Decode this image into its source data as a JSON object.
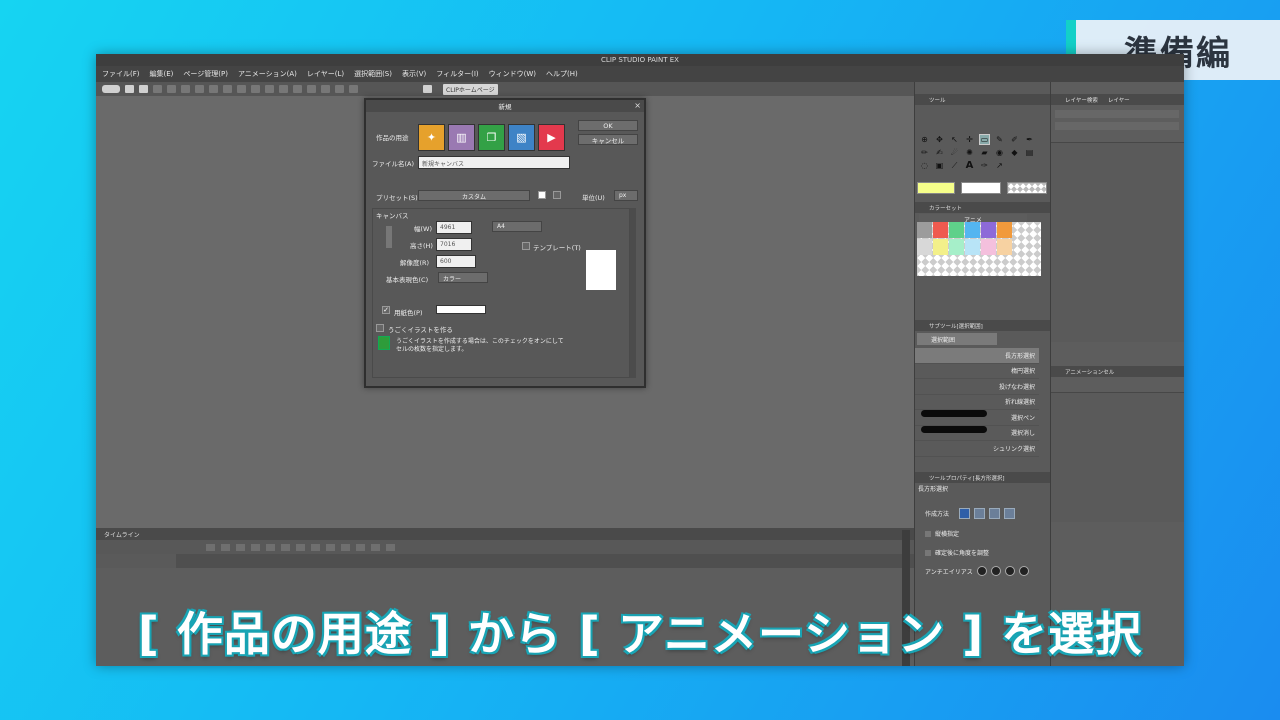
{
  "section_tag": "準備編",
  "caption": "[ 作品の用途 ] から [ アニメーション ] を選択",
  "app": {
    "title": "CLIP STUDIO PAINT EX",
    "menu": [
      "ファイル(F)",
      "編集(E)",
      "ページ管理(P)",
      "アニメーション(A)",
      "レイヤー(L)",
      "選択範囲(S)",
      "表示(V)",
      "フィルター(I)",
      "ウィンドウ(W)",
      "ヘルプ(H)"
    ],
    "clip_home_button": "CLIPホームページ"
  },
  "dialog": {
    "title": "新規",
    "use_label": "作品の用途",
    "ok": "OK",
    "cancel": "キャンセル",
    "filename_label": "ファイル名(A)",
    "filename_value": "新規キャンバス",
    "preset_label": "プリセット(S)",
    "preset_value": "カスタム",
    "unit_label": "単位(U)",
    "unit_value": "px",
    "canvas_section": "キャンバス",
    "width_label": "幅(W)",
    "width_value": "4961",
    "height_label": "高さ(H)",
    "height_value": "7016",
    "size_value": "A4",
    "resolution_label": "解像度(R)",
    "resolution_value": "600",
    "template_label": "テンプレート(T)",
    "color_mode_label": "基本表現色(C)",
    "color_mode_value": "カラー",
    "paper_color_label": "用紙色(P)",
    "animated_illust_label": "うごくイラストを作る",
    "info_text_1": "うごくイラストを作成する場合は、このチェックをオンにして",
    "info_text_2": "セルの枚数を指定します。"
  },
  "panels": {
    "tool_tab": "ツール",
    "color_set_tab": "カラーセット",
    "color_set_name": "アニメ",
    "subtool_tab": "サブツール[選択範囲]",
    "subtool_group": "選択範囲",
    "subtools": [
      "長方形選択",
      "楕円選択",
      "投げなわ選択",
      "折れ線選択",
      "選択ペン",
      "選択消し",
      "シュリンク選択"
    ],
    "tool_property_tab": "ツールプロパティ[長方形選択]",
    "tool_property_title": "長方形選択",
    "creation_method_label": "作成方法",
    "aspect_label": "縦横指定",
    "adjust_angle_label": "確定後に角度を調整",
    "antialias_label": "アンチエイリアス",
    "layer_tab": "レイヤー",
    "layer_props_tab": "レイヤー検索",
    "animation_cel_tab": "アニメーションセル",
    "timeline_tab": "タイムライン"
  },
  "colors": {
    "accent_teal": "#13d0c8",
    "selected_tool_blue": "#2f5fa8",
    "swatch_main": "#f6ff8a"
  }
}
